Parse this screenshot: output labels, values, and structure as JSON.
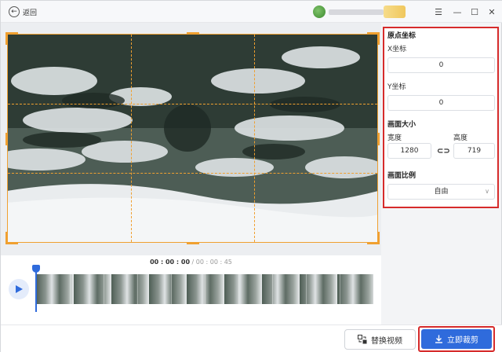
{
  "titlebar": {
    "back_label": "返回",
    "icons": [
      "arrow-left-icon",
      "menu-icon",
      "minimize-icon",
      "maximize-icon",
      "close-icon"
    ]
  },
  "player": {
    "time_current": "00 : 00 : 00",
    "time_separator": " / ",
    "time_total": "00 : 00 : 45"
  },
  "panel": {
    "origin_title": "原点坐标",
    "x_label": "X坐标",
    "x_value": "0",
    "y_label": "Y坐标",
    "y_value": "0",
    "size_title": "画面大小",
    "width_label": "宽度",
    "width_value": "1280",
    "height_label": "高度",
    "height_value": "719",
    "link_glyph": "⊂⊃",
    "ratio_title": "画面比例",
    "ratio_value": "自由"
  },
  "footer": {
    "replace_label": "替换视频",
    "crop_label": "立即裁剪"
  },
  "colors": {
    "accent": "#2f6bdc",
    "crop_frame": "#f0a030",
    "highlight_box": "#d62b2b"
  }
}
